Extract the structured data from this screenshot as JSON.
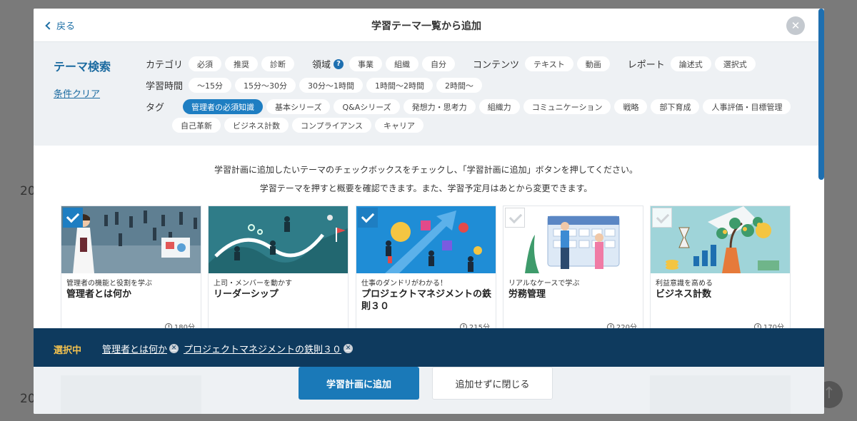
{
  "background": {
    "numbers": [
      "20",
      "20"
    ]
  },
  "header": {
    "back_label": "戻る",
    "title": "学習テーマ一覧から追加"
  },
  "filters": {
    "title": "テーマ検索",
    "clear_label": "条件クリア",
    "category": {
      "label": "カテゴリ",
      "options": [
        "必須",
        "推奨",
        "診断"
      ]
    },
    "domain": {
      "label": "領域",
      "options": [
        "事業",
        "組織",
        "自分"
      ]
    },
    "contents": {
      "label": "コンテンツ",
      "options": [
        "テキスト",
        "動画"
      ]
    },
    "report": {
      "label": "レポート",
      "options": [
        "論述式",
        "選択式"
      ]
    },
    "time": {
      "label": "学習時間",
      "options": [
        "〜15分",
        "15分〜30分",
        "30分〜1時間",
        "1時間〜2時間",
        "2時間〜"
      ]
    },
    "tags": {
      "label": "タグ",
      "row1": [
        "管理者の必須知識",
        "基本シリーズ",
        "Q&Aシリーズ",
        "発想力・思考力",
        "組織力",
        "コミュニケーション",
        "戦略",
        "部下育成",
        "人事評価・目標管理"
      ],
      "row2": [
        "自己革新",
        "ビジネス計数",
        "コンプライアンス",
        "キャリア"
      ],
      "active": "管理者の必須知識"
    }
  },
  "instructions": {
    "line1": "学習計画に追加したいテーマのチェックボックスをチェックし、「学習計画に追加」ボタンを押してください。",
    "line2": "学習テーマを押すと概要を確認できます。また、学習予定月はあとから変更できます。"
  },
  "cards": [
    {
      "subtitle": "管理者の機能と役割を学ぶ",
      "title": "管理者とは何か",
      "duration": "180分",
      "checked": true
    },
    {
      "subtitle": "上司・メンバーを動かす",
      "title": "リーダーシップ",
      "duration": "",
      "checked": false
    },
    {
      "subtitle": "仕事のダンドリがわかる！",
      "title": "プロジェクトマネジメントの鉄則３０",
      "duration": "215分",
      "checked": true
    },
    {
      "subtitle": "リアルなケースで学ぶ",
      "title": "労務管理",
      "duration": "220分",
      "checked": false
    },
    {
      "subtitle": "利益意識を高める",
      "title": "ビジネス計数",
      "duration": "170分",
      "checked": false
    }
  ],
  "selection": {
    "label": "選択中",
    "items": [
      "管理者とは何か",
      "プロジェクトマネジメントの鉄則３０"
    ]
  },
  "footer": {
    "add_label": "学習計画に追加",
    "close_label": "追加せずに閉じる"
  }
}
